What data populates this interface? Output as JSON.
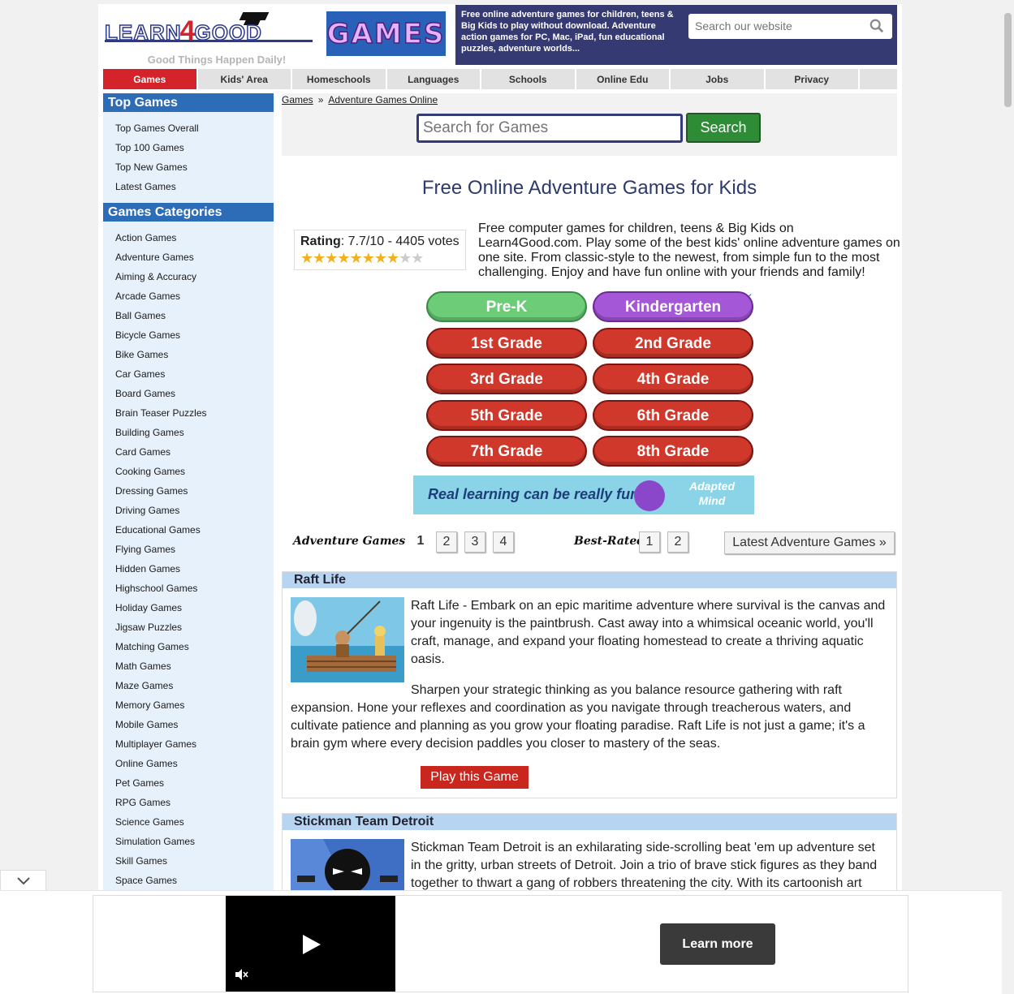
{
  "header": {
    "logo_text_left": "LEARN",
    "logo_text_four": "4",
    "logo_text_right": "GOOD",
    "tagline": "Good Things Happen Daily!",
    "games_logo": "GAMES",
    "description": "Free online adventure games for children, teens & Big Kids to play without download. Adventure action games for PC, Mac, iPad, fun educational puzzles, adventure worlds...",
    "search_placeholder": "Search our website"
  },
  "nav": [
    "Games",
    "Kids' Area",
    "Homeschools",
    "Languages",
    "Schools",
    "Online Edu",
    "Jobs",
    "Privacy"
  ],
  "sidebar": {
    "top_heading": "Top Games",
    "top_items": [
      "Top Games Overall",
      "Top 100 Games",
      "Top New Games",
      "Latest Games"
    ],
    "cat_heading": "Games Categories",
    "categories": [
      "Action Games",
      "Adventure Games",
      "Aiming & Accuracy",
      "Arcade Games",
      "Ball Games",
      "Bicycle Games",
      "Bike Games",
      "Car Games",
      "Board Games",
      "Brain Teaser Puzzles",
      "Building Games",
      "Card Games",
      "Cooking Games",
      "Dressing Games",
      "Driving Games",
      "Educational Games",
      "Flying Games",
      "Hidden Games",
      "Highschool Games",
      "Holiday Games",
      "Jigsaw Puzzles",
      "Matching Games",
      "Math Games",
      "Maze Games",
      "Memory Games",
      "Mobile Games",
      "Multiplayer Games",
      "Online Games",
      "Pet Games",
      "RPG Games",
      "Science Games",
      "Simulation Games",
      "Skill Games",
      "Space Games"
    ]
  },
  "breadcrumb": {
    "root": "Games",
    "sep": "»",
    "current": "Adventure Games Online"
  },
  "game_search": {
    "placeholder": "Search for Games",
    "button": "Search"
  },
  "title": "Free Online Adventure Games for Kids",
  "rating": {
    "label": "Rating",
    "value": ": 7.7/10 - 4405 votes",
    "stars_on": 8,
    "stars_total": 10
  },
  "intro": "Free computer games for children, teens & Big Kids on Learn4Good.com. Play some of the best kids' online adventure games on one site. From classic-style to the newest, from simple fun to the most challenging. Enjoy and have fun online with your friends and family!",
  "grade_ad": {
    "grades": [
      "Pre-K",
      "Kindergarten",
      "1st Grade",
      "2nd Grade",
      "3rd Grade",
      "4th Grade",
      "5th Grade",
      "6th Grade",
      "7th Grade",
      "8th Grade"
    ],
    "banner_text": "Real learning can be really fun",
    "brand": "Adapted Mind",
    "ad_choices": "ⓘ✕"
  },
  "pagination": {
    "adventure_label": "Adventure Games",
    "pages": [
      "1",
      "2",
      "3",
      "4"
    ],
    "best_label": "Best-Rated",
    "best_pages": [
      "1",
      "2"
    ],
    "latest_button": "Latest Adventure Games »"
  },
  "games": [
    {
      "title": "Raft Life",
      "p1": "Raft Life - Embark on an epic maritime adventure where survival is the canvas and your ingenuity is the paintbrush. Cast away into a whimsical oceanic world, you'll craft, manage, and expand your floating homestead to create a thriving aquatic oasis.",
      "p2": "Sharpen your strategic thinking as you balance resource gathering with raft expansion. Hone your reflexes and coordination as you navigate through treacherous waters, and cultivate patience and planning as you grow your floating paradise. Raft Life is not just a game; it's a brain gym where every decision paddles you closer to mastery of the seas.",
      "play": "Play this Game"
    },
    {
      "title": "Stickman Team Detroit",
      "p1": "Stickman Team Detroit is an exhilarating side-scrolling beat 'em up adventure set in the gritty, urban streets of Detroit. Join a trio of brave stick figures as they band together to thwart a gang of robbers threatening the city. With its cartoonish art"
    }
  ],
  "bottom_ad": {
    "learn_more": "Learn more"
  }
}
